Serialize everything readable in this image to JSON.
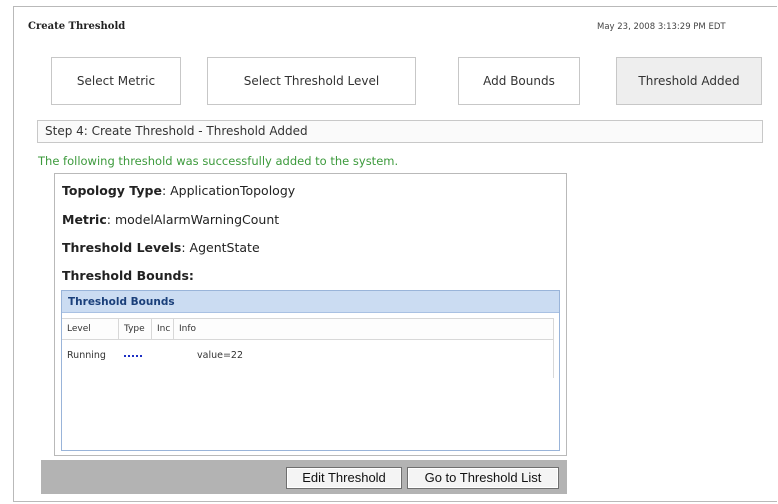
{
  "header": {
    "title": "Create Threshold",
    "timestamp": "May 23, 2008 3:13:29 PM EDT"
  },
  "steps": [
    {
      "label": "Select Metric",
      "active": false
    },
    {
      "label": "Select Threshold Level",
      "active": false
    },
    {
      "label": "Add Bounds",
      "active": false
    },
    {
      "label": "Threshold Added",
      "active": true
    }
  ],
  "step_bar": {
    "text": "Step 4: Create Threshold - Threshold Added"
  },
  "message": {
    "text": "The following threshold was successfully added to the system.",
    "color": "#3c9a3c"
  },
  "details": {
    "topology_label": "Topology Type",
    "topology_value": ": ApplicationTopology",
    "metric_label": "Metric",
    "metric_value": ": modelAlarmWarningCount",
    "levels_label": "Threshold Levels",
    "levels_value": ": AgentState",
    "bounds_label": "Threshold Bounds:"
  },
  "bounds_table": {
    "title": "Threshold Bounds",
    "columns": [
      "Level",
      "Type",
      "Inc",
      "Info"
    ],
    "rows": [
      {
        "level": "Running",
        "type_icon": "dotted-line-icon",
        "inc": "",
        "info": "value=22"
      }
    ]
  },
  "footer": {
    "edit_label": "Edit Threshold",
    "goto_label": "Go to Threshold List"
  }
}
